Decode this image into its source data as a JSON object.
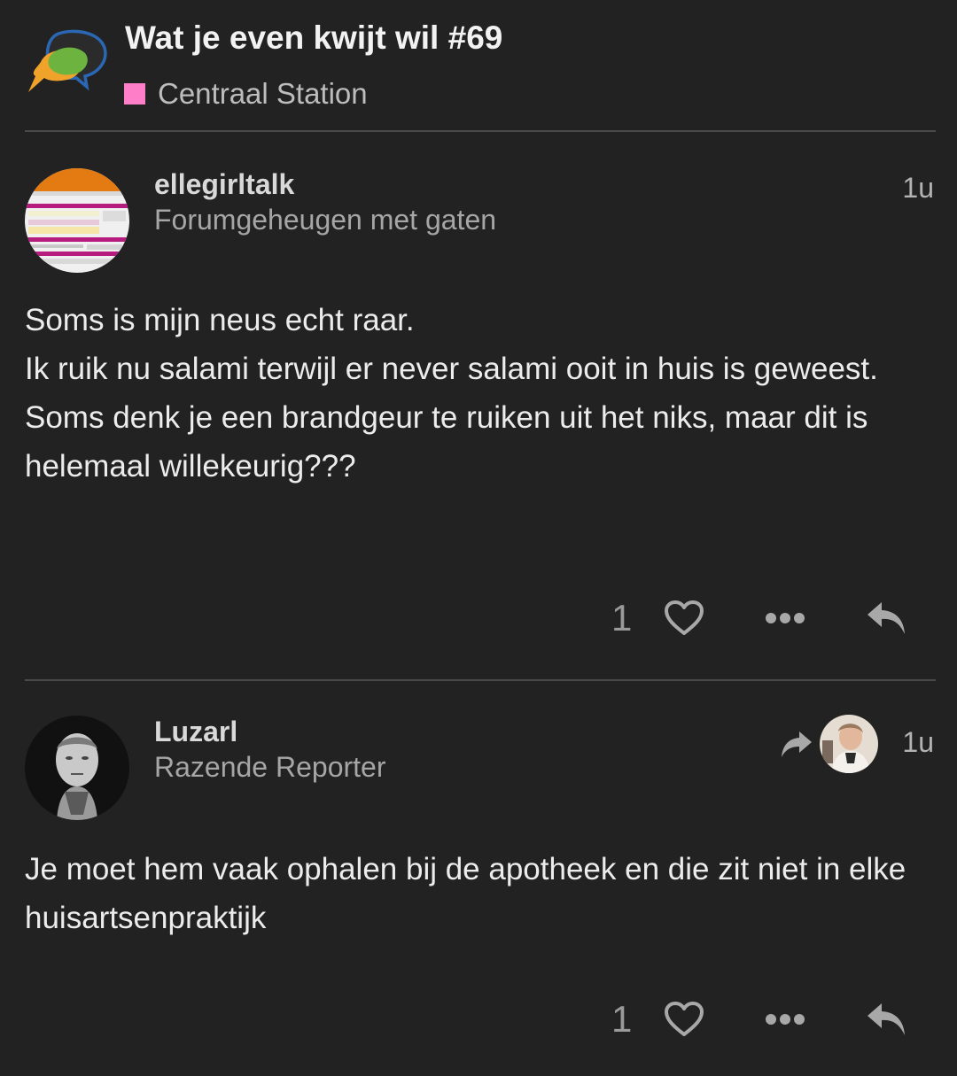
{
  "topic": {
    "title": "Wat je even kwijt wil #69",
    "category": "Centraal Station",
    "category_color": "#ff7ec8"
  },
  "icons": {
    "logo": "speech-bubbles-logo",
    "like": "heart-icon",
    "more": "more-dots-icon",
    "reply": "reply-arrow-icon",
    "reply_to": "share-arrow-icon"
  },
  "posts": [
    {
      "username": "ellegirltalk",
      "user_title": "Forumgeheugen met gaten",
      "date": "1u",
      "body": [
        "Soms is mijn neus echt raar.",
        "Ik ruik nu salami terwijl er never salami ooit in huis is geweest.",
        "Soms denk je een brandgeur te ruiken uit het niks, maar dit is helemaal willekeurig???"
      ],
      "likes": "1"
    },
    {
      "username": "Luzarl",
      "user_title": "Razende Reporter",
      "date": "1u",
      "body": [
        "Je moet hem vaak ophalen bij de apotheek en die zit niet in elke huisartsenpraktijk"
      ],
      "likes": "1"
    }
  ]
}
